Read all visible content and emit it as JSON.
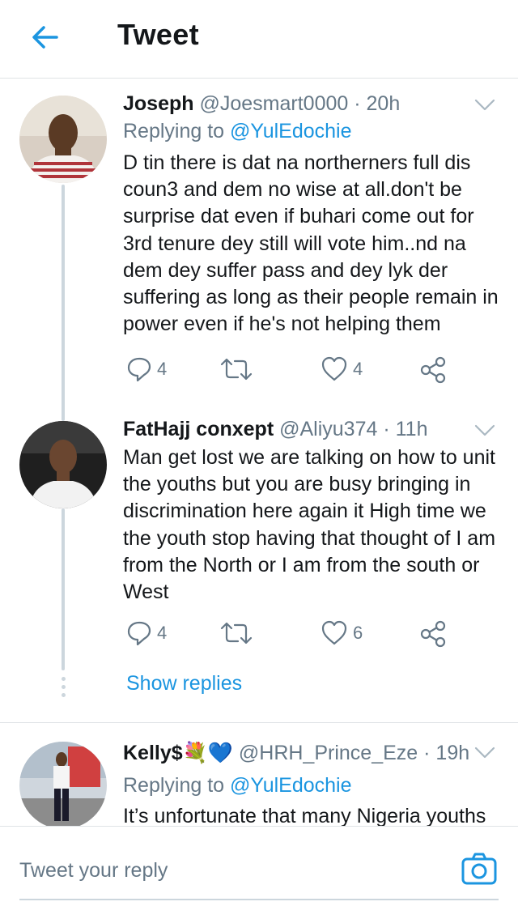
{
  "header": {
    "title": "Tweet",
    "back_icon": "arrow-left-icon"
  },
  "colors": {
    "accent": "#1b95e0",
    "muted": "#657786",
    "text": "#14171a",
    "divider": "#dfe3e6"
  },
  "tweets": [
    {
      "name": "Joseph",
      "handle": "@Joesmart0000",
      "time": "· 20h",
      "replying_label": "Replying to",
      "replying_handle": "@YulEdochie",
      "text": "D tin there is dat na northerners full dis coun3  and dem no wise at all.don't be surprise dat even if buhari come out for 3rd tenure dey still will vote him..nd na dem dey suffer pass and dey lyk der suffering as long as their people remain in power even if he's not helping them",
      "replies": "4",
      "retweets": "",
      "likes": "4"
    },
    {
      "name": "FatHajj conxept",
      "handle": "@Aliyu374",
      "time": "· 11h",
      "text": "Man get lost we are talking on how to unit the youths but you are busy bringing in discrimination here again it High time we the youth stop having that thought of I am from the North or I am from the south or West",
      "replies": "4",
      "retweets": "",
      "likes": "6"
    },
    {
      "name": "Kelly$",
      "emoji": "💐💙",
      "handle": "@HRH_Prince_Eze",
      "time": "· 19h",
      "replying_label": "Replying to",
      "replying_handle": "@YulEdochie",
      "text": "It’s unfortunate that many Nigeria youths"
    }
  ],
  "show_replies": "Show replies",
  "composer": {
    "placeholder": "Tweet your reply",
    "camera_icon": "camera-icon"
  }
}
